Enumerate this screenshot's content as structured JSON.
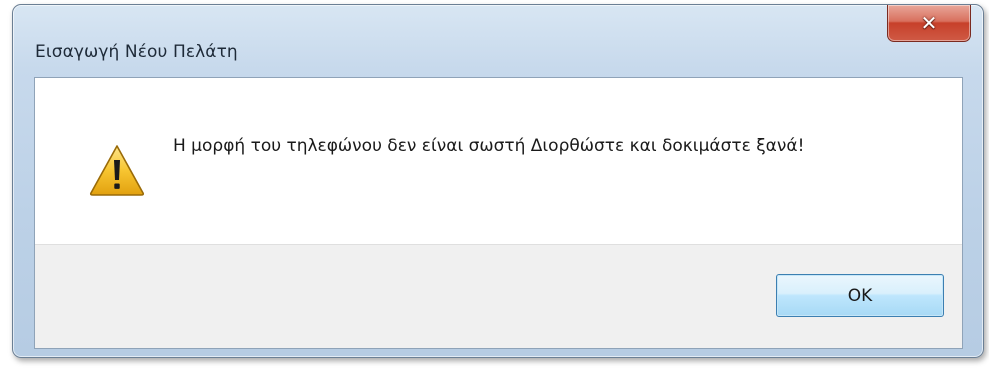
{
  "window": {
    "title": "Εισαγωγή Νέου Πελάτη",
    "close_glyph": "✕",
    "close_icon": "close-icon"
  },
  "dialog": {
    "icon": "warning-icon",
    "message": "Η μορφή του τηλεφώνου δεν είναι σωστή Διορθώστε και δοκιμάστε ξανά!",
    "ok_label": "OK"
  },
  "colors": {
    "close_button": "#c7402a",
    "warning_fill": "#f7c531",
    "ok_button_border": "#3c7fb1"
  }
}
